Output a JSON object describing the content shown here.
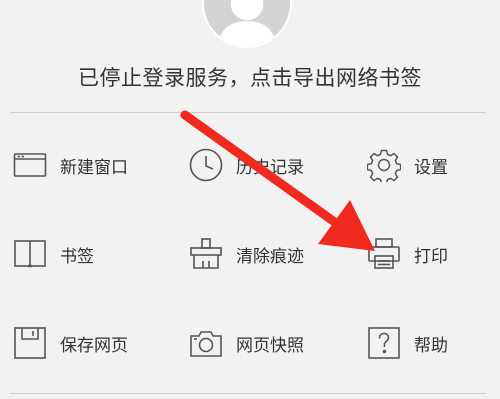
{
  "header": {
    "status_text": "已停止登录服务，点击导出网络书签"
  },
  "menu": {
    "items": [
      {
        "label": "新建窗口",
        "icon": "new-window-icon"
      },
      {
        "label": "历史记录",
        "icon": "clock-icon"
      },
      {
        "label": "设置",
        "icon": "gear-icon"
      },
      {
        "label": "书签",
        "icon": "book-icon"
      },
      {
        "label": "清除痕迹",
        "icon": "clear-traces-icon"
      },
      {
        "label": "打印",
        "icon": "printer-icon"
      },
      {
        "label": "保存网页",
        "icon": "save-page-icon"
      },
      {
        "label": "网页快照",
        "icon": "camera-icon"
      },
      {
        "label": "帮助",
        "icon": "help-icon"
      }
    ]
  },
  "colors": {
    "background": "#f2f2f2",
    "text": "#333333",
    "icon": "#555555",
    "annotation_arrow": "#f02a1e"
  }
}
